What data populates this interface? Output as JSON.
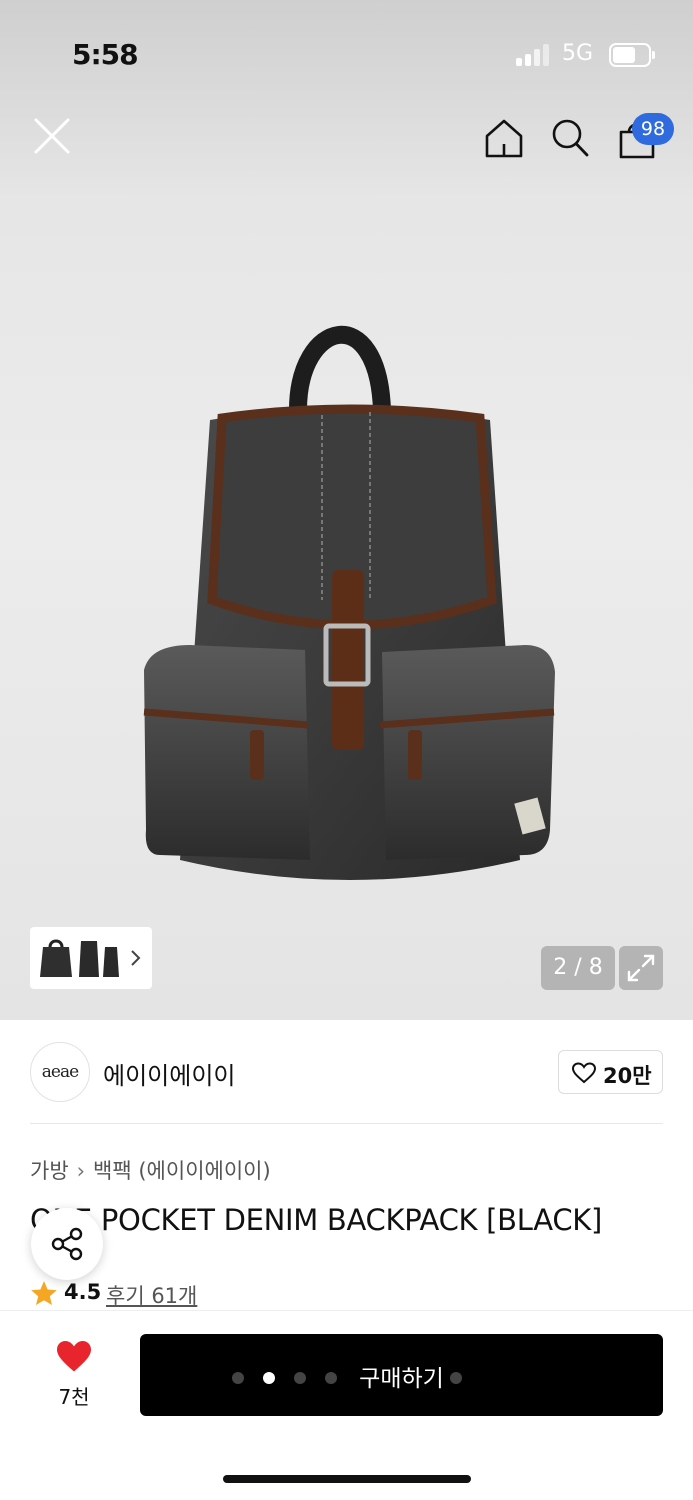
{
  "status_bar": {
    "time": "5:58",
    "network": "5G"
  },
  "header": {
    "cart_badge": "98"
  },
  "gallery": {
    "counter": "2 / 8",
    "active_dot": 1,
    "dot_count": 5
  },
  "brand": {
    "logo_text": "aeae",
    "name": "에이이에이이",
    "likes": "20만"
  },
  "breadcrumb": {
    "items": [
      "가방",
      "백팩 (에이이에이이)"
    ]
  },
  "product": {
    "title": "ONE POCKET DENIM BACKPACK [BLACK]",
    "rating": "4.5",
    "reviews": "후기 61개"
  },
  "bottom_bar": {
    "favorites": "7천",
    "buy_label": "구매하기"
  },
  "colors": {
    "accent": "#2f6bde",
    "heart": "#e8242c",
    "star": "#f5a623",
    "buy_button": "#000000"
  },
  "icons": [
    "close-icon",
    "home-icon",
    "search-icon",
    "cart-icon",
    "chevron-right-icon",
    "expand-icon",
    "heart-outline-icon",
    "share-icon",
    "star-icon",
    "heart-filled-icon"
  ]
}
